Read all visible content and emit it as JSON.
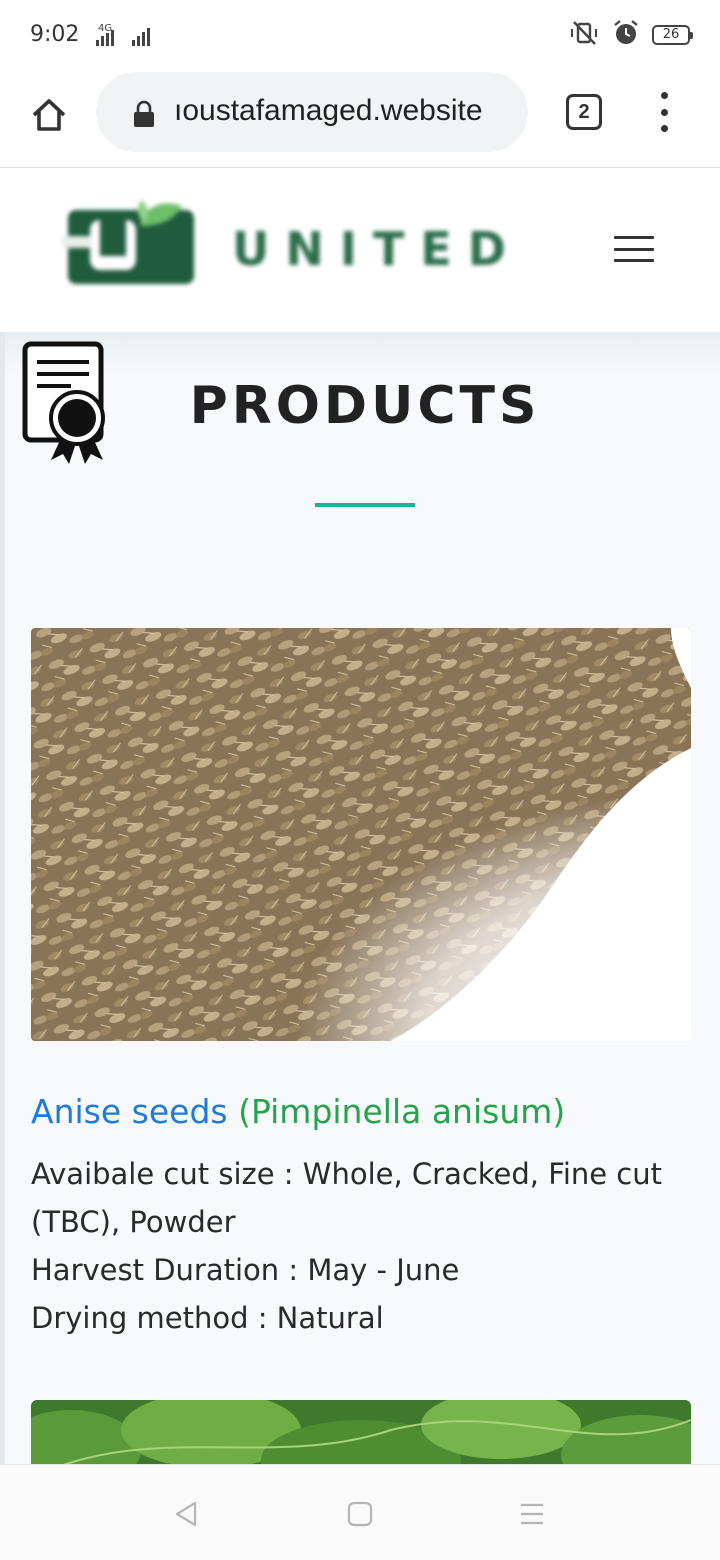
{
  "status_bar": {
    "time": "9:02",
    "network_label": "4G",
    "battery_level": "26"
  },
  "browser": {
    "url": "ıoustafamaged.website",
    "tab_count": "2"
  },
  "site": {
    "logo_text": "UNITED"
  },
  "section": {
    "title": "PRODUCTS",
    "accent_color": "#1fb09a"
  },
  "products": [
    {
      "name_common": "Anise seeds ",
      "name_latin": "(Pimpinella anisum)",
      "details": [
        "Avaibale cut size : Whole, Cracked, Fine cut (TBC), Powder",
        "Harvest Duration : May - June",
        "Drying method : Natural"
      ]
    }
  ],
  "colors": {
    "product_name": "#1f7ad8",
    "latin_name": "#27a34b",
    "logo_green": "#2b6e4b"
  }
}
